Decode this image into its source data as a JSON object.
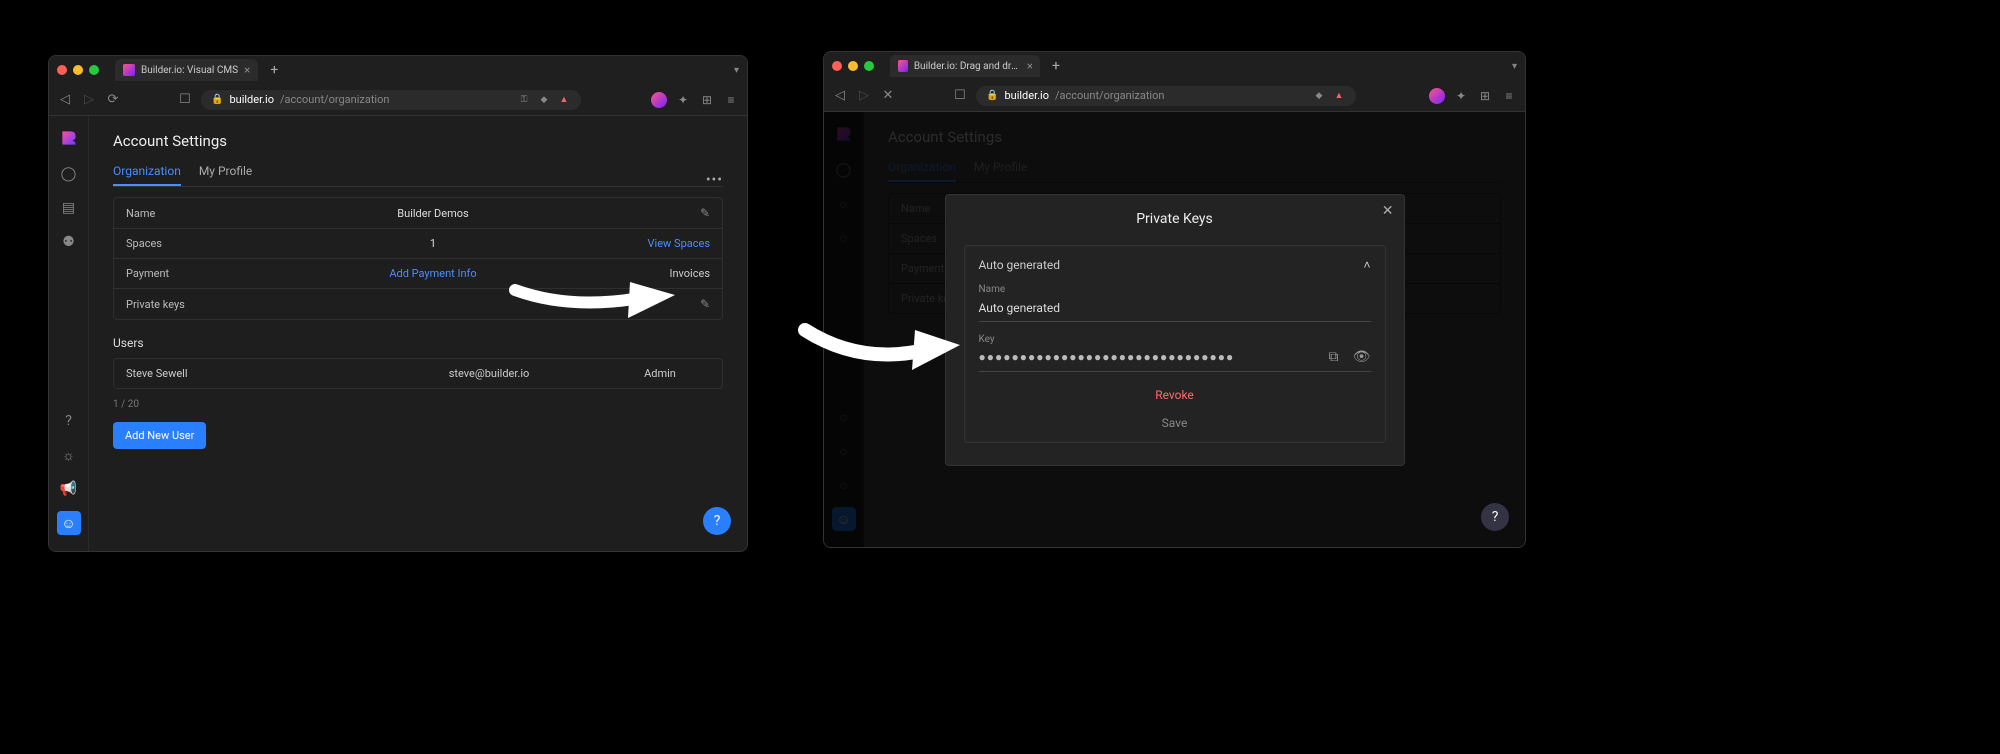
{
  "left": {
    "tabTitle": "Builder.io: Visual CMS",
    "urlDomain": "builder.io",
    "urlPath": "/account/organization",
    "pageTitle": "Account Settings",
    "tabs": {
      "org": "Organization",
      "profile": "My Profile"
    },
    "rows": {
      "name": {
        "label": "Name",
        "value": "Builder Demos"
      },
      "spaces": {
        "label": "Spaces",
        "value": "1",
        "action": "View Spaces"
      },
      "payment": {
        "label": "Payment",
        "addLink": "Add Payment Info",
        "invoices": "Invoices"
      },
      "keys": {
        "label": "Private keys"
      }
    },
    "usersHeader": "Users",
    "user": {
      "name": "Steve Sewell",
      "email": "steve@builder.io",
      "role": "Admin"
    },
    "pager": "1 / 20",
    "addUser": "Add New User"
  },
  "right": {
    "tabTitle": "Builder.io: Drag and drop Visu",
    "urlDomain": "builder.io",
    "urlPath": "/account/organization",
    "pageTitle": "Account Settings",
    "tabs": {
      "org": "Organization",
      "profile": "My Profile"
    },
    "rows": {
      "name": "Name",
      "spaces": "Spaces",
      "payment": "Payment",
      "keys": "Private keys"
    },
    "modal": {
      "title": "Private Keys",
      "expHeader": "Auto generated",
      "nameLabel": "Name",
      "nameValue": "Auto generated",
      "keyLabel": "Key",
      "keyMask": "●●●●●●●●●●●●●●●●●●●●●●●●●●●●●●●",
      "revoke": "Revoke",
      "save": "Save"
    }
  }
}
